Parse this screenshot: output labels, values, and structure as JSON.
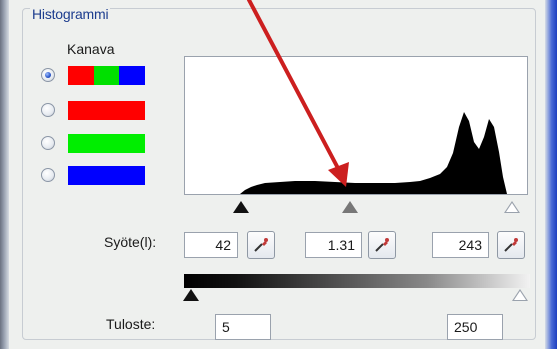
{
  "panel": {
    "title": "Histogrammi"
  },
  "channel": {
    "label": "Kanava",
    "options": [
      {
        "name": "rgb",
        "checked": true,
        "colors": [
          "#ff0000",
          "#00e000",
          "#0000ff"
        ]
      },
      {
        "name": "red",
        "checked": false,
        "colors": [
          "#ff0000"
        ]
      },
      {
        "name": "green",
        "checked": false,
        "colors": [
          "#00ee00"
        ]
      },
      {
        "name": "blue",
        "checked": false,
        "colors": [
          "#0000ff"
        ]
      }
    ]
  },
  "input": {
    "label": "Syöte(l):",
    "black": "42",
    "gamma": "1.31",
    "white": "243"
  },
  "output": {
    "label": "Tuloste:",
    "black": "5",
    "white": "250"
  },
  "annotation": {
    "color": "#cc1f1f"
  }
}
